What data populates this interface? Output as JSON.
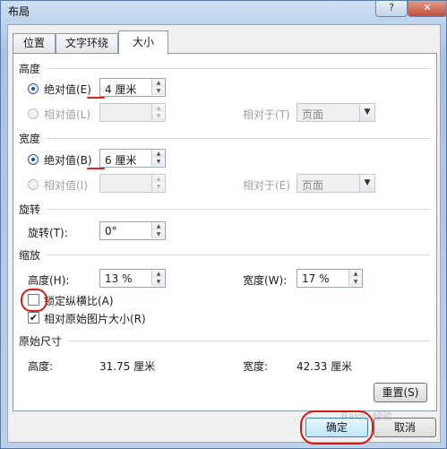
{
  "window": {
    "title": "布局",
    "help": "?",
    "close": "✕"
  },
  "tabs": [
    "位置",
    "文字环绕",
    "大小"
  ],
  "height": {
    "section": "高度",
    "absolute_label": "绝对值(E)",
    "absolute_value": "4 厘米",
    "relative_label": "相对值(L)",
    "relative_to_label": "相对于(T)",
    "relative_to_value": "页面"
  },
  "width": {
    "section": "宽度",
    "absolute_label": "绝对值(B)",
    "absolute_value": "6 厘米",
    "relative_label": "相对值(I)",
    "relative_to_label": "相对于(E)",
    "relative_to_value": "页面"
  },
  "rotate": {
    "section": "旋转",
    "label": "旋转(T):",
    "value": "0°"
  },
  "scale": {
    "section": "缩放",
    "height_label": "高度(H):",
    "height_value": "13 %",
    "width_label": "宽度(W):",
    "width_value": "17 %",
    "lock_aspect": "锁定纵横比(A)",
    "relative_original": "相对原始图片大小(R)"
  },
  "original": {
    "section": "原始尺寸",
    "height_label": "高度:",
    "height_value": "31.75 厘米",
    "width_label": "宽度:",
    "width_value": "42.33 厘米",
    "reset": "重置(S)"
  },
  "footer": {
    "ok": "确定",
    "cancel": "取消"
  },
  "watermark": "Baidu 经验"
}
